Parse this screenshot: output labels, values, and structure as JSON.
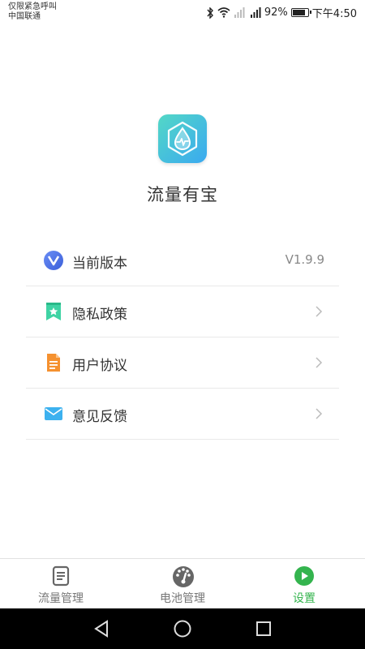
{
  "status_bar": {
    "carrier_line1": "仅限紧急呼叫",
    "carrier_line2": "中国联通",
    "battery_percent": "92%",
    "battery_level": 0.92,
    "time": "下午4:50",
    "icons": [
      "bluetooth-icon",
      "wifi-icon",
      "signal-icon",
      "signal-icon"
    ]
  },
  "app": {
    "name": "流量有宝",
    "logo_icon": "shield-drop-pulse-icon"
  },
  "settings_list": [
    {
      "label": "当前版本",
      "value": "V1.9.9",
      "icon": "v-logo-icon"
    },
    {
      "label": "隐私政策",
      "icon": "bookmark-star-icon"
    },
    {
      "label": "用户协议",
      "icon": "document-icon"
    },
    {
      "label": "意见反馈",
      "icon": "mail-icon"
    }
  ],
  "bottom_nav": [
    {
      "label": "流量管理",
      "icon": "clipboard-icon",
      "active": false
    },
    {
      "label": "电池管理",
      "icon": "gauge-icon",
      "active": false
    },
    {
      "label": "设置",
      "icon": "play-circle-icon",
      "active": true
    }
  ],
  "colors": {
    "accent_green": "#34b44e",
    "logo_gradient": [
      "#53d8c6",
      "#3aa9f0"
    ]
  }
}
